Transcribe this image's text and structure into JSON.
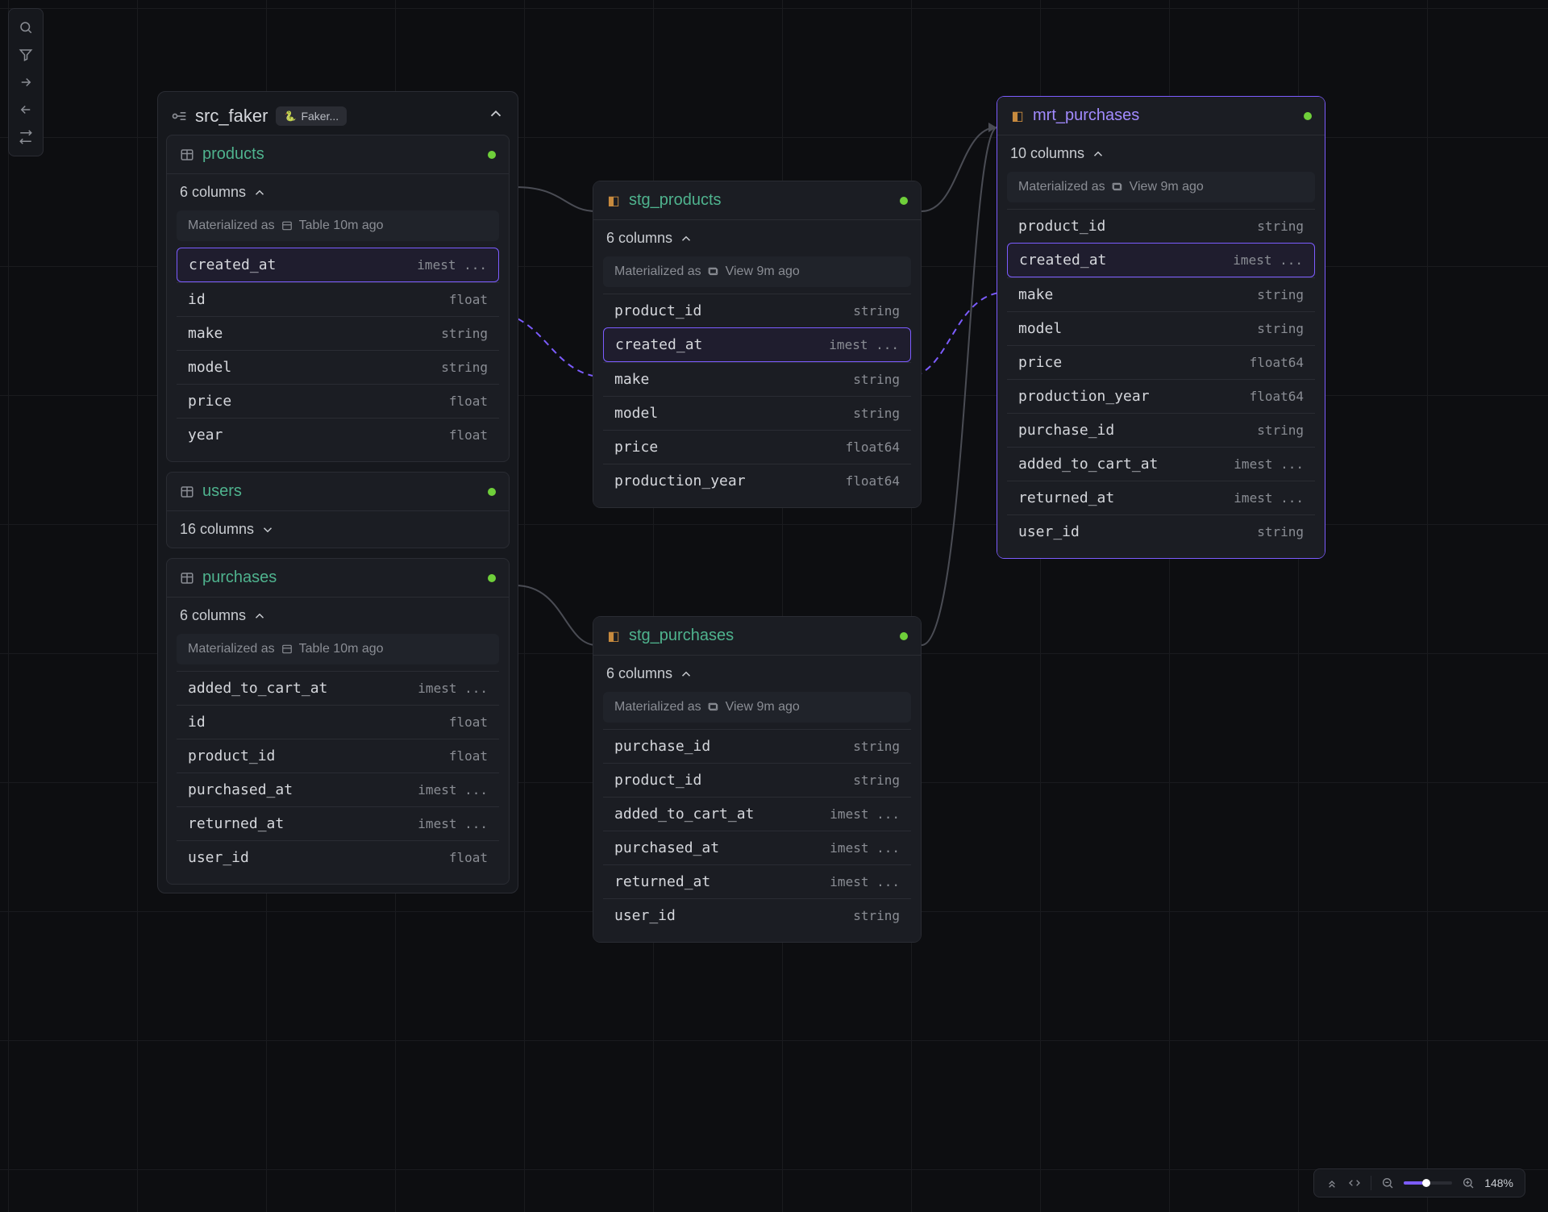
{
  "sidebar_icons": [
    "search",
    "filter",
    "arrow-right",
    "arrow-left",
    "swap"
  ],
  "zoom": {
    "label": "148%"
  },
  "src_faker": {
    "title": "src_faker",
    "badge": "Faker...",
    "products": {
      "title": "products",
      "columns_label": "6 columns",
      "materialized": "Materialized as",
      "mat_type": "Table 10m ago",
      "cols": [
        {
          "n": "created_at",
          "t": "imest ..."
        },
        {
          "n": "id",
          "t": "float"
        },
        {
          "n": "make",
          "t": "string"
        },
        {
          "n": "model",
          "t": "string"
        },
        {
          "n": "price",
          "t": "float"
        },
        {
          "n": "year",
          "t": "float"
        }
      ]
    },
    "users": {
      "title": "users",
      "columns_label": "16 columns"
    },
    "purchases": {
      "title": "purchases",
      "columns_label": "6 columns",
      "materialized": "Materialized as",
      "mat_type": "Table 10m ago",
      "cols": [
        {
          "n": "added_to_cart_at",
          "t": "imest ..."
        },
        {
          "n": "id",
          "t": "float"
        },
        {
          "n": "product_id",
          "t": "float"
        },
        {
          "n": "purchased_at",
          "t": "imest ..."
        },
        {
          "n": "returned_at",
          "t": "imest ..."
        },
        {
          "n": "user_id",
          "t": "float"
        }
      ]
    }
  },
  "stg_products": {
    "title": "stg_products",
    "columns_label": "6 columns",
    "materialized": "Materialized as",
    "mat_type": "View 9m ago",
    "cols": [
      {
        "n": "product_id",
        "t": "string"
      },
      {
        "n": "created_at",
        "t": "imest ..."
      },
      {
        "n": "make",
        "t": "string"
      },
      {
        "n": "model",
        "t": "string"
      },
      {
        "n": "price",
        "t": "float64"
      },
      {
        "n": "production_year",
        "t": "float64"
      }
    ]
  },
  "stg_purchases": {
    "title": "stg_purchases",
    "columns_label": "6 columns",
    "materialized": "Materialized as",
    "mat_type": "View 9m ago",
    "cols": [
      {
        "n": "purchase_id",
        "t": "string"
      },
      {
        "n": "product_id",
        "t": "string"
      },
      {
        "n": "added_to_cart_at",
        "t": "imest ..."
      },
      {
        "n": "purchased_at",
        "t": "imest ..."
      },
      {
        "n": "returned_at",
        "t": "imest ..."
      },
      {
        "n": "user_id",
        "t": "string"
      }
    ]
  },
  "mrt_purchases": {
    "title": "mrt_purchases",
    "columns_label": "10 columns",
    "materialized": "Materialized as",
    "mat_type": "View 9m ago",
    "cols": [
      {
        "n": "product_id",
        "t": "string"
      },
      {
        "n": "created_at",
        "t": "imest ..."
      },
      {
        "n": "make",
        "t": "string"
      },
      {
        "n": "model",
        "t": "string"
      },
      {
        "n": "price",
        "t": "float64"
      },
      {
        "n": "production_year",
        "t": "float64"
      },
      {
        "n": "purchase_id",
        "t": "string"
      },
      {
        "n": "added_to_cart_at",
        "t": "imest ..."
      },
      {
        "n": "returned_at",
        "t": "imest ..."
      },
      {
        "n": "user_id",
        "t": "string"
      }
    ]
  }
}
